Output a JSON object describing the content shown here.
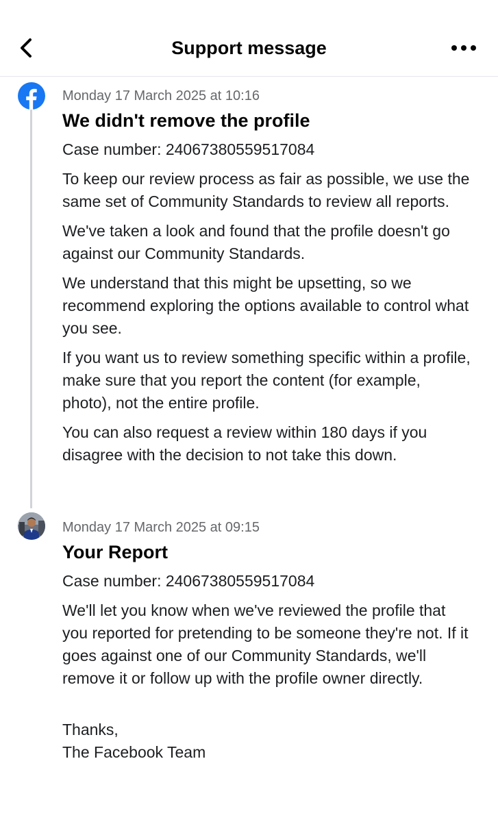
{
  "header": {
    "title": "Support message",
    "back_icon": "chevron-left-icon",
    "more_icon": "more-horizontal-icon"
  },
  "colors": {
    "facebook_blue": "#1877f2",
    "timestamp_gray": "#65676b",
    "divider": "#e4e6eb",
    "timeline": "#d0d3d8"
  },
  "messages": [
    {
      "icon": "facebook-logo-icon",
      "timestamp": "Monday 17 March 2025 at 10:16",
      "title": "We didn't remove the profile",
      "case_number": "Case number: 24067380559517084",
      "paragraphs": [
        "To keep our review process as fair as possible, we use the same set of Community Standards to review all reports.",
        "We've taken a look and found that the profile doesn't go against our Community Standards.",
        "We understand that this might be upsetting, so we recommend exploring the options available to control what you see.",
        "If you want us to review something specific within a profile, make sure that you report the content (for example, photo), not the entire profile.",
        "You can also request a review within 180 days if you disagree with the decision to not take this down."
      ]
    },
    {
      "icon": "user-avatar",
      "timestamp": "Monday 17 March 2025 at 09:15",
      "title": "Your Report",
      "case_number": "Case number: 24067380559517084",
      "paragraphs": [
        "We'll let you know when we've reviewed the profile that you reported for pretending to be someone they're not. If it goes against one of our Community Standards, we'll remove it or follow up with the profile owner directly."
      ],
      "signoff": [
        "Thanks,",
        "The Facebook Team"
      ]
    }
  ]
}
